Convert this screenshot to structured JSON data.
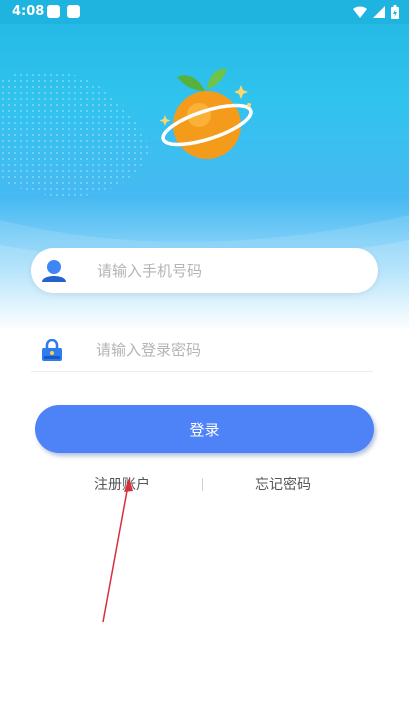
{
  "status_bar": {
    "time": "4:08"
  },
  "login_form": {
    "phone_placeholder": "请输入手机号码",
    "password_placeholder": "请输入登录密码",
    "login_button": "登录",
    "register_link": "注册账户",
    "forgot_link": "忘记密码"
  },
  "colors": {
    "accent": "#4e82f7",
    "hero_top": "#22b6e3",
    "logo_orange": "#f59b1c"
  }
}
